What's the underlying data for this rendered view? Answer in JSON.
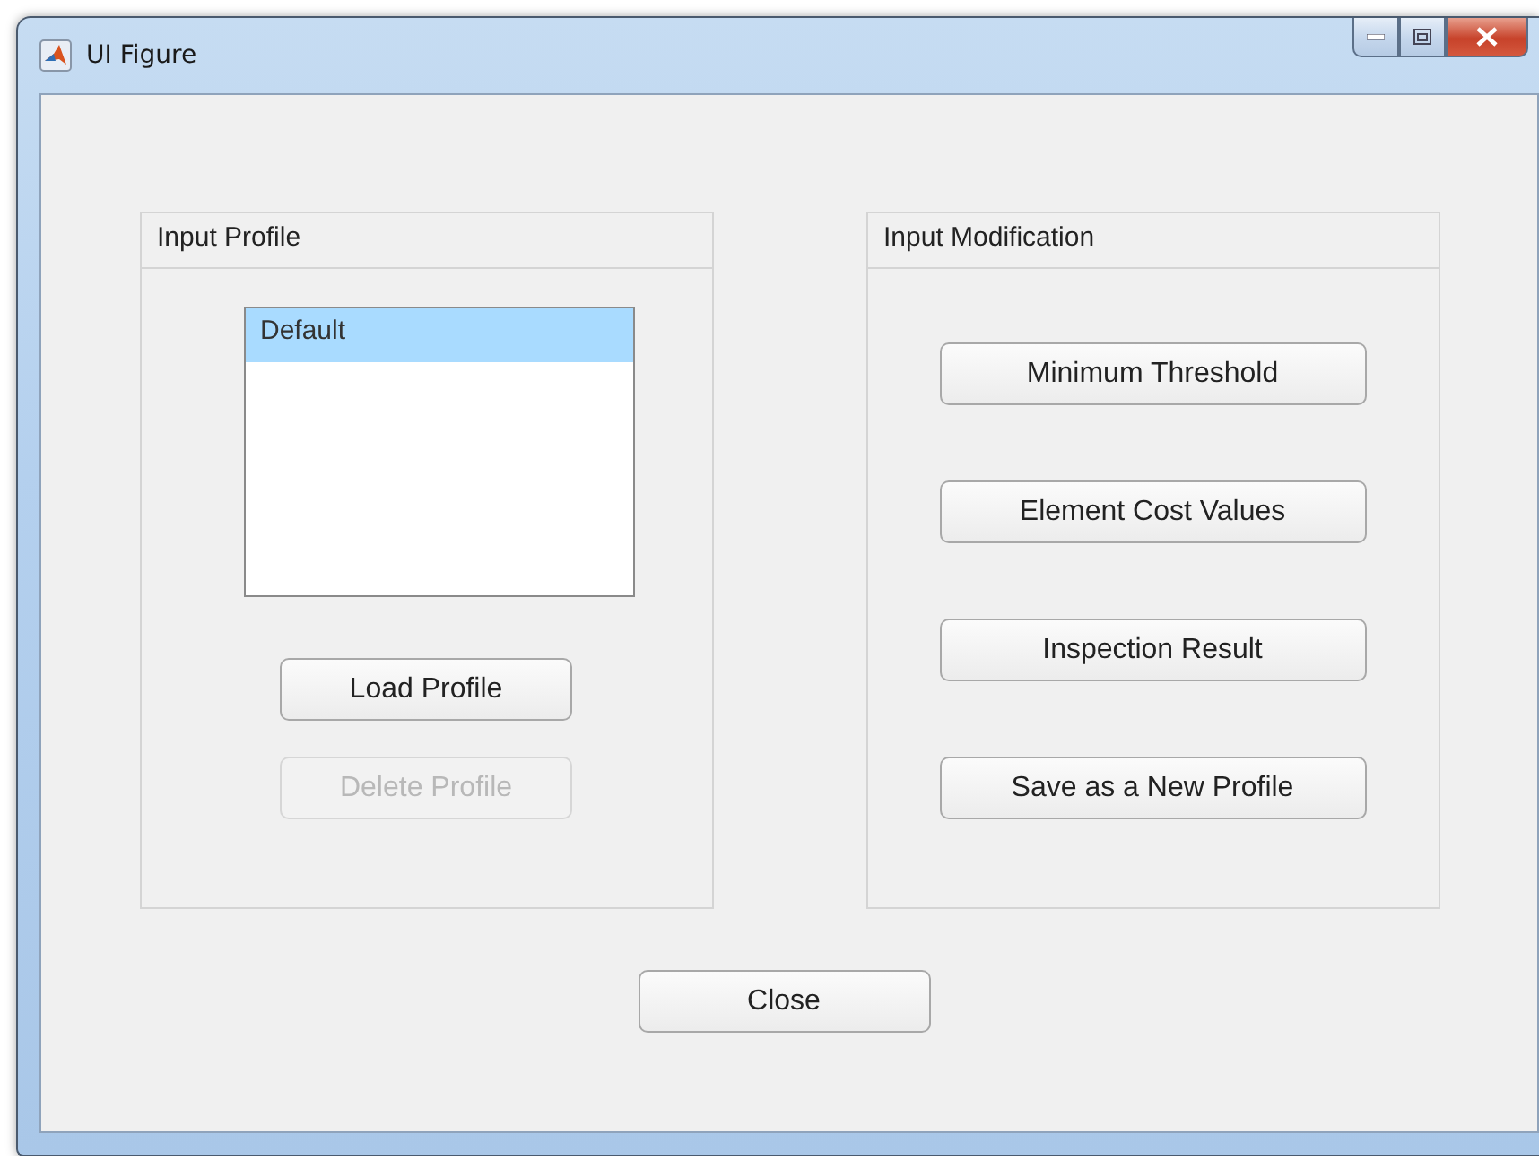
{
  "window": {
    "title": "UI Figure"
  },
  "panels": [
    {
      "kind": "profile",
      "title": "Input Profile",
      "list": {
        "items": [
          {
            "label": "Default",
            "selected": true
          }
        ]
      },
      "buttons": [
        {
          "label": "Load Profile",
          "disabled": false
        },
        {
          "label": "Delete Profile",
          "disabled": true
        }
      ]
    },
    {
      "kind": "actions",
      "title": "Input Modification",
      "buttons": [
        {
          "label": "Minimum Threshold",
          "disabled": false
        },
        {
          "label": "Element Cost Values",
          "disabled": false
        },
        {
          "label": "Inspection Result",
          "disabled": false
        },
        {
          "label": "Save as a New Profile",
          "disabled": false
        }
      ]
    }
  ],
  "close_button": {
    "label": "Close",
    "disabled": false
  }
}
